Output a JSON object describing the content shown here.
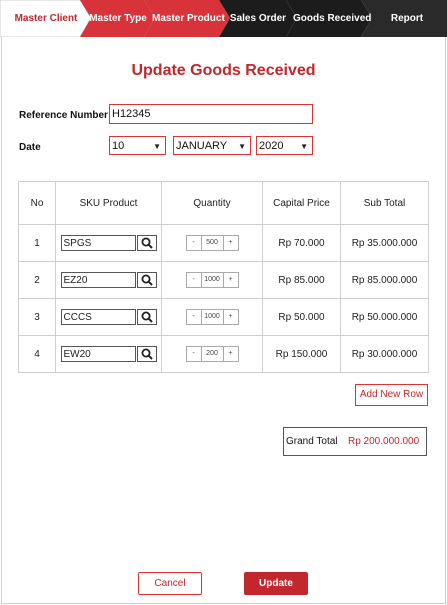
{
  "steps": [
    {
      "label": "Master Client",
      "active": true
    },
    {
      "label": "Master Type"
    },
    {
      "label": "Master Product"
    },
    {
      "label": "Sales Order"
    },
    {
      "label": "Goods Received"
    },
    {
      "label": "Report"
    }
  ],
  "colors": {
    "accent": "#c1272d",
    "step_red": "#d8323a",
    "step_dark": "#1c1c1c"
  },
  "page": {
    "title": "Update Goods Received"
  },
  "form": {
    "reference_label": "Reference Number",
    "reference_value": "H12345",
    "date_label": "Date",
    "day": "10",
    "month": "JANUARY",
    "year": "2020"
  },
  "table": {
    "headers": [
      "No",
      "SKU Product",
      "Quantity",
      "Capital Price",
      "Sub Total"
    ],
    "rows": [
      {
        "no": "1",
        "sku": "SPGS",
        "qty": "500",
        "price": "Rp 70.000",
        "subtotal": "Rp 35.000.000"
      },
      {
        "no": "2",
        "sku": "EZ20",
        "qty": "1000",
        "price": "Rp 85.000",
        "subtotal": "Rp 85.000.000"
      },
      {
        "no": "3",
        "sku": "CCCS",
        "qty": "1000",
        "price": "Rp 50.000",
        "subtotal": "Rp 50.000.000"
      },
      {
        "no": "4",
        "sku": "EW20",
        "qty": "200",
        "price": "Rp 150.000",
        "subtotal": "Rp 30.000.000"
      }
    ],
    "minus": "-",
    "plus": "+"
  },
  "actions": {
    "add_row": "Add New Row",
    "grand_total_label": "Grand Total",
    "grand_total_value": "Rp 200.000.000",
    "cancel": "Cancel",
    "update": "Update"
  }
}
